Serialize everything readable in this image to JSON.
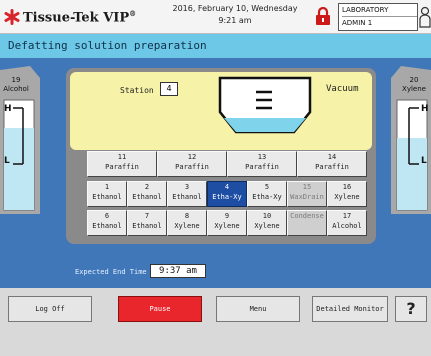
{
  "header": {
    "app_name": "Tissue-Tek VIP",
    "app_trademark": "®",
    "date": "2016, February 10, Wednesday",
    "time": "9:21 am",
    "user_role": "LABORATORY",
    "user_name": "ADMIN 1",
    "colors": {
      "lock": "#cc1a1a",
      "logo_mark": "#d8242a"
    }
  },
  "title": "Defatting solution preparation",
  "retort": {
    "station_label": "Station",
    "station_value": "4",
    "status": "Vacuum"
  },
  "bottles": {
    "left": {
      "number": "19",
      "name": "Alcohol",
      "high": "H",
      "low": "L",
      "fill_fraction": 0.75
    },
    "right": {
      "number": "20",
      "name": "Xylene",
      "high": "H",
      "low": "L",
      "fill_fraction": 0.65
    }
  },
  "paraffin_stations": [
    {
      "number": "11",
      "name": "Paraffin"
    },
    {
      "number": "12",
      "name": "Paraffin"
    },
    {
      "number": "13",
      "name": "Paraffin"
    },
    {
      "number": "14",
      "name": "Paraffin"
    }
  ],
  "row_upper": [
    {
      "number": "1",
      "name": "Ethanol"
    },
    {
      "number": "2",
      "name": "Ethanol"
    },
    {
      "number": "3",
      "name": "Ethanol"
    },
    {
      "number": "4",
      "name": "Etha-Xy",
      "selected": true
    },
    {
      "number": "5",
      "name": "Etha-Xy"
    },
    {
      "number": "15",
      "name": "WaxDrain",
      "faded": true
    },
    {
      "number": "16",
      "name": "Xylene"
    }
  ],
  "row_lower": [
    {
      "number": "6",
      "name": "Ethanol"
    },
    {
      "number": "7",
      "name": "Ethanol"
    },
    {
      "number": "8",
      "name": "Xylene"
    },
    {
      "number": "9",
      "name": "Xylene"
    },
    {
      "number": "10",
      "name": "Xylene"
    },
    {
      "number": "",
      "name": "Condense",
      "faded": true
    },
    {
      "number": "17",
      "name": "Alcohol"
    }
  ],
  "expected_end": {
    "label": "Expected End Time",
    "value": "9:37 am"
  },
  "bottom": {
    "logoff": "Log Off",
    "pause": "Pause",
    "menu": "Menu",
    "detailed_monitor": "Detailed Monitor",
    "help": "?"
  }
}
